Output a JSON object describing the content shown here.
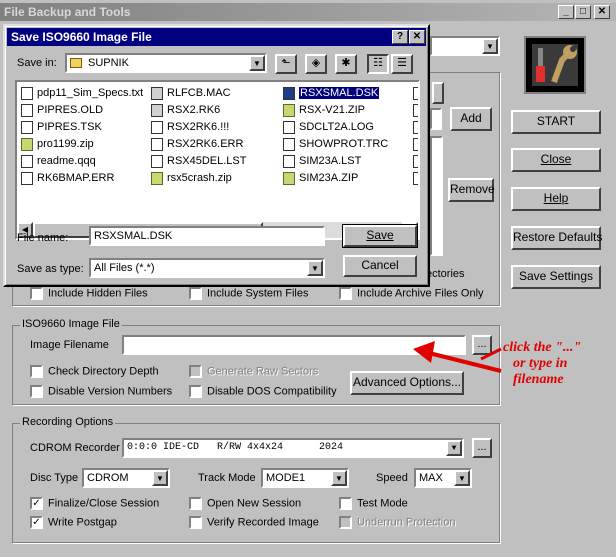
{
  "main": {
    "title": "File Backup and Tools",
    "buttons": {
      "add": "Add",
      "remove": "Remove",
      "start": "START",
      "close": "Close",
      "help": "Help",
      "restore": "Restore Defaults",
      "save_settings": "Save Settings"
    },
    "partial_text": "ectories",
    "include": {
      "hidden": "Include Hidden Files",
      "system": "Include System Files",
      "archive": "Include Archive Files Only"
    },
    "iso": {
      "group": "ISO9660 Image File",
      "filename_label": "Image Filename",
      "filename_value": "",
      "browse": "...",
      "check_dir": "Check Directory Depth",
      "gen_raw": "Generate Raw Sectors",
      "disable_ver": "Disable Version Numbers",
      "disable_dos": "Disable DOS Compatibility",
      "advanced": "Advanced Options..."
    },
    "recording": {
      "group": "Recording Options",
      "recorder_label": "CDROM Recorder",
      "recorder_value": "0:0:0 IDE-CD   R/RW 4x4x24      2024",
      "browse": "...",
      "disc_type_label": "Disc Type",
      "disc_type_value": "CDROM",
      "track_mode_label": "Track Mode",
      "track_mode_value": "MODE1",
      "speed_label": "Speed",
      "speed_value": "MAX",
      "finalize": "Finalize/Close Session",
      "open_new": "Open New Session",
      "test_mode": "Test Mode",
      "write_postgap": "Write Postgap",
      "verify": "Verify Recorded Image",
      "underrun": "Underrun Protection"
    }
  },
  "dialog": {
    "title": "Save ISO9660 Image File",
    "help_glyph": "?",
    "close_glyph": "✕",
    "save_in_label": "Save in:",
    "save_in_value": "SUPNIK",
    "file_name_label": "File name:",
    "file_name_value": "RSXSMAL.DSK",
    "save_as_label": "Save as type:",
    "save_as_value": "All Files (*.*)",
    "save_button": "Save",
    "cancel_button": "Cancel",
    "files": [
      {
        "name": "pdp11_Sim_Specs.txt",
        "icon": "text-file-icon"
      },
      {
        "name": "PIPRES.OLD",
        "icon": "file-icon"
      },
      {
        "name": "PIPRES.TSK",
        "icon": "file-icon"
      },
      {
        "name": "pro1199.zip",
        "icon": "zip-icon"
      },
      {
        "name": "readme.qqq",
        "icon": "file-icon"
      },
      {
        "name": "RK6BMAP.ERR",
        "icon": "file-icon"
      },
      {
        "name": "RLFCB.MAC",
        "icon": "exe-icon"
      },
      {
        "name": "RSX2.RK6",
        "icon": "exe-icon"
      },
      {
        "name": "RSX2RK6.!!!",
        "icon": "file-icon"
      },
      {
        "name": "RSX2RK6.ERR",
        "icon": "file-icon"
      },
      {
        "name": "RSX45DEL.LST",
        "icon": "file-icon"
      },
      {
        "name": "rsx5crash.zip",
        "icon": "zip-icon"
      },
      {
        "name": "RSXSMAL.DSK",
        "icon": "disk-image-icon"
      },
      {
        "name": "RSX-V21.ZIP",
        "icon": "zip-icon"
      },
      {
        "name": "SDCLT2A.LOG",
        "icon": "file-icon"
      },
      {
        "name": "SHOWPROT.TRC",
        "icon": "file-icon"
      },
      {
        "name": "SIM23A.LST",
        "icon": "file-icon"
      },
      {
        "name": "SIM23A.ZIP",
        "icon": "zip-icon"
      }
    ]
  },
  "annotation": {
    "line1": "click the \"...\"",
    "line2": "or type in",
    "line3": "filename",
    "color": "#e00000"
  }
}
